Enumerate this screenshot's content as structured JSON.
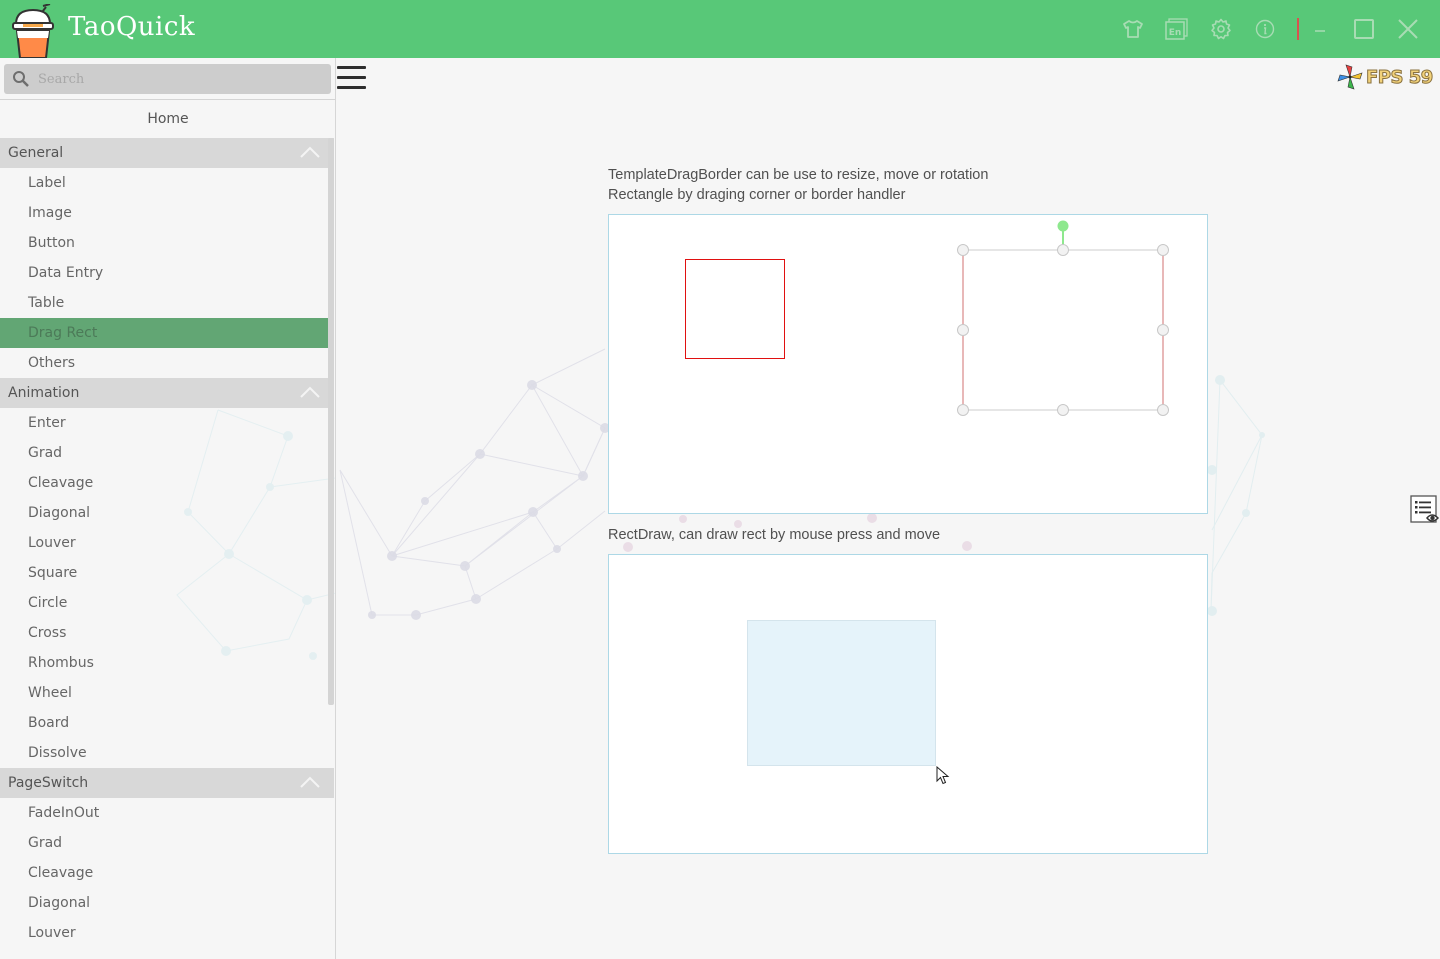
{
  "app": {
    "title": "TaoQuick",
    "accent_color": "#58c878",
    "logo_icon": "bubble-tea-cup-icon"
  },
  "titlebar": {
    "buttons": [
      {
        "name": "skin-button",
        "icon": "tshirt-icon"
      },
      {
        "name": "language-button",
        "icon": "language-en-icon",
        "label": "En"
      },
      {
        "name": "settings-button",
        "icon": "gear-icon"
      },
      {
        "name": "about-button",
        "icon": "info-icon"
      },
      {
        "name": "minimize-button",
        "icon": "minimize-icon"
      },
      {
        "name": "maximize-button",
        "icon": "maximize-icon"
      },
      {
        "name": "close-button",
        "icon": "close-icon"
      }
    ]
  },
  "sidebar": {
    "search": {
      "placeholder": "Search",
      "value": ""
    },
    "home_label": "Home",
    "groups": [
      {
        "label": "General",
        "expanded": true,
        "items": [
          "Label",
          "Image",
          "Button",
          "Data Entry",
          "Table",
          "Drag Rect",
          "Others"
        ]
      },
      {
        "label": "Animation",
        "expanded": true,
        "items": [
          "Enter",
          "Grad",
          "Cleavage",
          "Diagonal",
          "Louver",
          "Square",
          "Circle",
          "Cross",
          "Rhombus",
          "Wheel",
          "Board",
          "Dissolve"
        ]
      },
      {
        "label": "PageSwitch",
        "expanded": true,
        "items": [
          "FadeInOut",
          "Grad",
          "Cleavage",
          "Diagonal",
          "Louver"
        ]
      }
    ],
    "active_item": "Drag Rect",
    "active_color": "#62a674"
  },
  "fps": {
    "label": "FPS 59",
    "value": 59
  },
  "main": {
    "drag_border": {
      "description_line1": "TemplateDragBorder can be use to resize, move or rotation",
      "description_line2": "Rectangle by draging corner or border handler",
      "rect_color": "#e01010",
      "rotate_handle_color": "#8ee88e"
    },
    "rect_draw": {
      "description": "RectDraw, can draw rect by mouse press and move",
      "drawn_rect_color": "#e5f3fa"
    },
    "side_button_icon": "list-view-icon"
  }
}
